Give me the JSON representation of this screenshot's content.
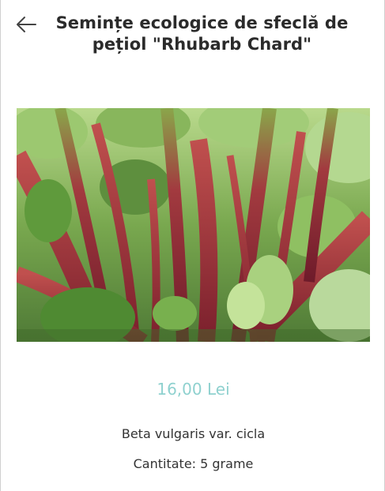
{
  "header": {
    "title": "Semințe ecologice de sfeclă de pețiol \"Rhubarb Chard\"",
    "back_icon": "arrow-left-icon"
  },
  "product": {
    "image_alt": "Rhubarb Chard",
    "price": "16,00 Lei",
    "latin_name": "Beta vulgaris var. cicla",
    "quantity": "Cantitate: 5 grame"
  },
  "colors": {
    "price": "#8fd1cf",
    "title": "#2b2b2b",
    "stem": "#9e2a3a",
    "leaf": "#6aa84f"
  }
}
